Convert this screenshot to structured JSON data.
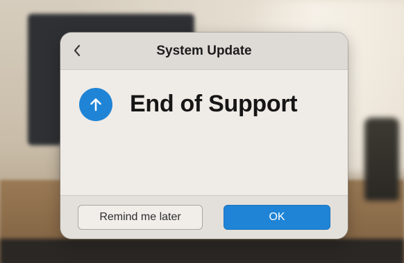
{
  "dialog": {
    "title": "System Update",
    "heading": "End of Support",
    "back_icon": "chevron-left-icon",
    "status_icon": "arrow-up-icon",
    "accent_color": "#1f84d6",
    "buttons": {
      "remind_label": "Remind me later",
      "ok_label": "OK"
    }
  }
}
